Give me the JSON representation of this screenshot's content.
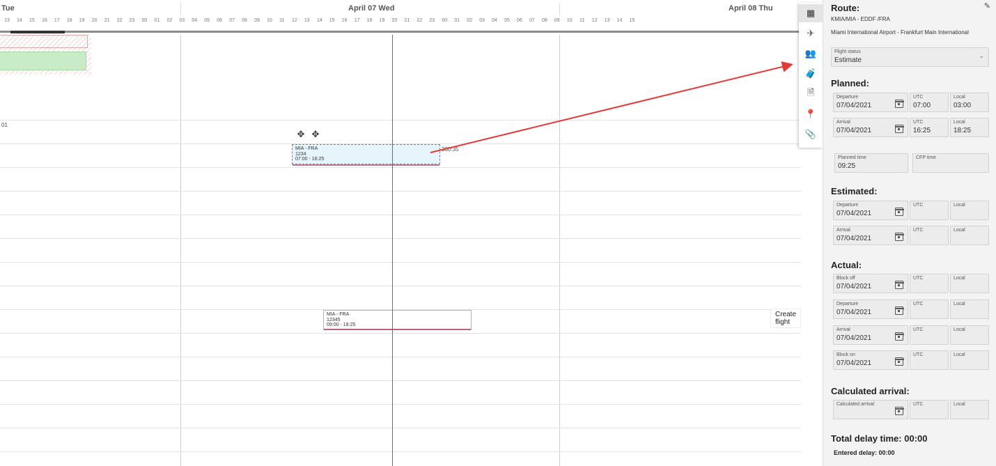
{
  "timeline": {
    "days": [
      {
        "label": "Tue"
      },
      {
        "label": "April 07 Wed"
      },
      {
        "label": "April 08 Thu"
      }
    ],
    "hours": [
      "13",
      "14",
      "15",
      "16",
      "17",
      "18",
      "19",
      "20",
      "21",
      "22",
      "23",
      "00",
      "01",
      "02",
      "03",
      "04",
      "05",
      "06",
      "07",
      "08",
      "09",
      "10",
      "11",
      "12",
      "13",
      "14",
      "15",
      "16",
      "17",
      "18",
      "19",
      "20",
      "21",
      "22",
      "23",
      "00",
      "01",
      "02",
      "03",
      "04",
      "05",
      "06",
      "07",
      "08",
      "09",
      "10",
      "11",
      "12",
      "13",
      "14",
      "15"
    ],
    "row_label": "01",
    "flights": [
      {
        "route": "MIA - FRA",
        "number": "1234",
        "time": "07:00 - 16:25",
        "side_label": "360:35"
      },
      {
        "route": "MIA - FRA",
        "number": "12345",
        "time": "09:00 - 18:25"
      }
    ],
    "create_flight_tooltip": "Create flight",
    "arrow_color": "#e53935",
    "now_line_color": "#e53935"
  },
  "toolbar": {
    "items": [
      {
        "icon": "calendar-check-icon",
        "glyph": "▦"
      },
      {
        "icon": "flight-add-icon",
        "glyph": "✈"
      },
      {
        "icon": "crew-icon",
        "glyph": "👥"
      },
      {
        "icon": "luggage-icon",
        "glyph": "🧳"
      },
      {
        "icon": "document-icon",
        "glyph": "🗎"
      },
      {
        "icon": "location-pin-icon",
        "glyph": "📍"
      },
      {
        "icon": "attachment-icon",
        "glyph": "📎"
      }
    ]
  },
  "panel": {
    "route_title": "Route:",
    "route_codes": "KMIA/MIA - EDDF /FRA",
    "route_names": "Miami International Airport - Frankfurt Main International",
    "flight_status": {
      "label": "Flight status",
      "value": "Estimate"
    },
    "planned": {
      "title": "Planned:",
      "departure": {
        "label": "Departure",
        "date": "07/04/2021",
        "utc": "07:00",
        "local": "03:00"
      },
      "arrival": {
        "label": "Arrival",
        "date": "07/04/2021",
        "utc": "16:25",
        "local": "18:25"
      },
      "planned_time": {
        "label": "Planned time",
        "value": "09:25"
      },
      "cfp_time": {
        "label": "CFP time",
        "value": ""
      }
    },
    "estimated": {
      "title": "Estimated:",
      "departure": {
        "label": "Departure",
        "date": "07/04/2021"
      },
      "arrival": {
        "label": "Arrival",
        "date": "07/04/2021"
      }
    },
    "actual": {
      "title": "Actual:",
      "block_off": {
        "label": "Block off",
        "date": "07/04/2021"
      },
      "departure": {
        "label": "Departure",
        "date": "07/04/2021"
      },
      "arrival": {
        "label": "Arrival",
        "date": "07/04/2021"
      },
      "block_on": {
        "label": "Block on",
        "date": "07/04/2021"
      }
    },
    "calculated": {
      "title": "Calculated arrival:",
      "label": "Calculated arrival"
    },
    "utc_label": "UTC",
    "local_label": "Local",
    "total_delay": "Total delay time: 00:00",
    "entered_delay": "Entered delay: 00:00"
  }
}
